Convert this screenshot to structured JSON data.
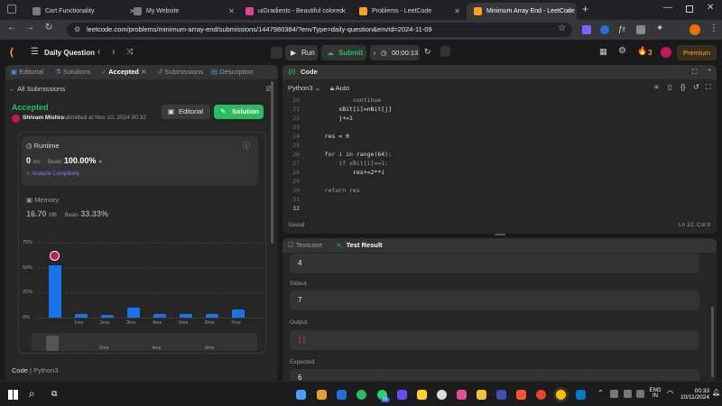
{
  "browser": {
    "tabs": [
      {
        "title": "Cart Functionality",
        "color": "#7a7a7a"
      },
      {
        "title": "My Website",
        "color": "#7a7a7a"
      },
      {
        "title": "uiGradients - Beautiful colored",
        "color": "#e84393"
      },
      {
        "title": "Problems - LeetCode",
        "color": "#ffa116"
      },
      {
        "title": "Minimum Array End - LeetCode",
        "color": "#ffa116"
      }
    ],
    "url": "leetcode.com/problems/minimum-array-end/submissions/1447980384/?envType=daily-question&envId=2024-11-09"
  },
  "lc_nav": {
    "daily": "Daily Question",
    "run": "Run",
    "submit": "Submit",
    "timer": "00:00:13",
    "streak": "3",
    "premium": "Premium"
  },
  "left": {
    "tabs": [
      "Editorial",
      "Solutions",
      "Accepted",
      "Submissions",
      "Description"
    ],
    "all_submissions": "All Submissions",
    "status": "Accepted",
    "user": "Shivam Mishra",
    "submitted": "submitted at Nov 10, 2024 00:32",
    "editorial_btn": "Editorial",
    "solution_btn": "Solution",
    "runtime_label": "Runtime",
    "runtime_value": "0",
    "runtime_unit": "ms",
    "beats_label": "Beats",
    "runtime_beats": "100.00%",
    "analyze": "Analyze Complexity",
    "memory_label": "Memory",
    "memory_value": "16.70",
    "memory_unit": "MB",
    "memory_beats": "33.33%",
    "footer_code": "Code",
    "footer_lang": "Python3"
  },
  "chart_data": {
    "type": "bar",
    "y_ticks": [
      "75%",
      "50%",
      "25%",
      "0%"
    ],
    "x_labels": [
      "",
      "1ms",
      "2ms",
      "3ms",
      "4ms",
      "5ms",
      "6ms",
      "7ms"
    ],
    "values": [
      52,
      4,
      3,
      10,
      4,
      4,
      4,
      8
    ],
    "ylim": [
      0,
      75
    ],
    "minimap_labels": [
      "2ms",
      "4ms",
      "6ms"
    ]
  },
  "code": {
    "title": "Code",
    "lang": "Python3",
    "auto": "Auto",
    "saved": "Saved",
    "position": "Ln 32, Col 9",
    "lines": [
      {
        "n": "20",
        "t": "            continue"
      },
      {
        "n": "21",
        "t": "        xBit[i]=nBit[j]"
      },
      {
        "n": "22",
        "t": "        j+=1"
      },
      {
        "n": "23",
        "t": ""
      },
      {
        "n": "24",
        "t": "    res = 0"
      },
      {
        "n": "25",
        "t": ""
      },
      {
        "n": "26",
        "t": "    for i in range(64):"
      },
      {
        "n": "27",
        "t": "        if xBit[i]==1:"
      },
      {
        "n": "28",
        "t": "            res+=2**i"
      },
      {
        "n": "29",
        "t": ""
      },
      {
        "n": "30",
        "t": "    return res"
      },
      {
        "n": "31",
        "t": ""
      },
      {
        "n": "32",
        "t": ""
      }
    ]
  },
  "testcase": {
    "tab1": "Testcase",
    "tab2": "Test Result",
    "top_value": "4",
    "stdout_label": "Stdout",
    "stdout_value": "7",
    "output_label": "Output",
    "output_value": "[]",
    "expected_label": "Expected",
    "expected_value": "6"
  },
  "taskbar": {
    "lang": "ENG",
    "region": "IN",
    "time": "00:33",
    "date": "10/11/2024",
    "badge": "86"
  }
}
